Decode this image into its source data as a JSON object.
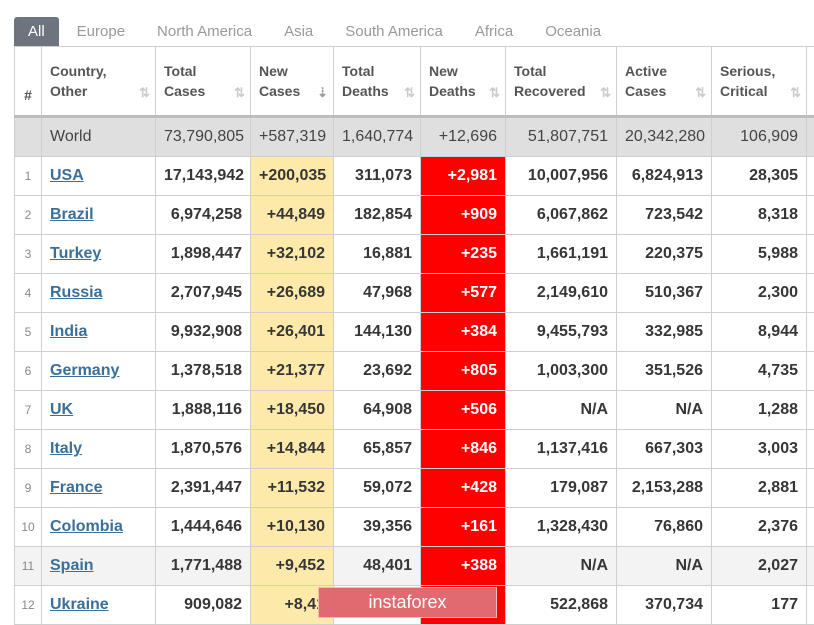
{
  "tabs": [
    {
      "label": "All",
      "active": true
    },
    {
      "label": "Europe",
      "active": false
    },
    {
      "label": "North America",
      "active": false
    },
    {
      "label": "Asia",
      "active": false
    },
    {
      "label": "South America",
      "active": false
    },
    {
      "label": "Africa",
      "active": false
    },
    {
      "label": "Oceania",
      "active": false
    }
  ],
  "table": {
    "headers": [
      {
        "line1": "#",
        "line2": ""
      },
      {
        "line1": "Country,",
        "line2": "Other"
      },
      {
        "line1": "Total",
        "line2": "Cases"
      },
      {
        "line1": "New",
        "line2": "Cases"
      },
      {
        "line1": "Total",
        "line2": "Deaths"
      },
      {
        "line1": "New",
        "line2": "Deaths"
      },
      {
        "line1": "Total",
        "line2": "Recovered"
      },
      {
        "line1": "Active",
        "line2": "Cases"
      },
      {
        "line1": "Serious,",
        "line2": "Critical"
      }
    ],
    "sort_icon": "⇅",
    "sort_active_icon": "⇣",
    "world": {
      "country": "World",
      "total_cases": "73,790,805",
      "new_cases": "+587,319",
      "total_deaths": "1,640,774",
      "new_deaths": "+12,696",
      "total_recovered": "51,807,751",
      "active_cases": "20,342,280",
      "serious_critical": "106,909"
    },
    "rows": [
      {
        "rank": "1",
        "country": "USA",
        "total_cases": "17,143,942",
        "new_cases": "+200,035",
        "total_deaths": "311,073",
        "new_deaths": "+2,981",
        "total_recovered": "10,007,956",
        "active_cases": "6,824,913",
        "serious_critical": "28,305"
      },
      {
        "rank": "2",
        "country": "Brazil",
        "total_cases": "6,974,258",
        "new_cases": "+44,849",
        "total_deaths": "182,854",
        "new_deaths": "+909",
        "total_recovered": "6,067,862",
        "active_cases": "723,542",
        "serious_critical": "8,318"
      },
      {
        "rank": "3",
        "country": "Turkey",
        "total_cases": "1,898,447",
        "new_cases": "+32,102",
        "total_deaths": "16,881",
        "new_deaths": "+235",
        "total_recovered": "1,661,191",
        "active_cases": "220,375",
        "serious_critical": "5,988"
      },
      {
        "rank": "4",
        "country": "Russia",
        "total_cases": "2,707,945",
        "new_cases": "+26,689",
        "total_deaths": "47,968",
        "new_deaths": "+577",
        "total_recovered": "2,149,610",
        "active_cases": "510,367",
        "serious_critical": "2,300"
      },
      {
        "rank": "5",
        "country": "India",
        "total_cases": "9,932,908",
        "new_cases": "+26,401",
        "total_deaths": "144,130",
        "new_deaths": "+384",
        "total_recovered": "9,455,793",
        "active_cases": "332,985",
        "serious_critical": "8,944"
      },
      {
        "rank": "6",
        "country": "Germany",
        "total_cases": "1,378,518",
        "new_cases": "+21,377",
        "total_deaths": "23,692",
        "new_deaths": "+805",
        "total_recovered": "1,003,300",
        "active_cases": "351,526",
        "serious_critical": "4,735"
      },
      {
        "rank": "7",
        "country": "UK",
        "total_cases": "1,888,116",
        "new_cases": "+18,450",
        "total_deaths": "64,908",
        "new_deaths": "+506",
        "total_recovered": "N/A",
        "active_cases": "N/A",
        "serious_critical": "1,288"
      },
      {
        "rank": "8",
        "country": "Italy",
        "total_cases": "1,870,576",
        "new_cases": "+14,844",
        "total_deaths": "65,857",
        "new_deaths": "+846",
        "total_recovered": "1,137,416",
        "active_cases": "667,303",
        "serious_critical": "3,003"
      },
      {
        "rank": "9",
        "country": "France",
        "total_cases": "2,391,447",
        "new_cases": "+11,532",
        "total_deaths": "59,072",
        "new_deaths": "+428",
        "total_recovered": "179,087",
        "active_cases": "2,153,288",
        "serious_critical": "2,881"
      },
      {
        "rank": "10",
        "country": "Colombia",
        "total_cases": "1,444,646",
        "new_cases": "+10,130",
        "total_deaths": "39,356",
        "new_deaths": "+161",
        "total_recovered": "1,328,430",
        "active_cases": "76,860",
        "serious_critical": "2,376"
      },
      {
        "rank": "11",
        "country": "Spain",
        "total_cases": "1,771,488",
        "new_cases": "+9,452",
        "total_deaths": "48,401",
        "new_deaths": "+388",
        "total_recovered": "N/A",
        "active_cases": "N/A",
        "serious_critical": "2,027",
        "highlight": true
      },
      {
        "rank": "12",
        "country": "Ukraine",
        "total_cases": "909,082",
        "new_cases": "+8,41",
        "total_deaths": "",
        "new_deaths": "",
        "total_recovered": "522,868",
        "active_cases": "370,734",
        "serious_critical": "177"
      }
    ]
  },
  "colors": {
    "tab_active_bg": "#6c757d",
    "new_cases_bg": "#fdeaab",
    "new_deaths_bg": "#ff0000",
    "world_row_bg": "#dfdfdf",
    "link_color": "#3a6f99"
  },
  "watermark": {
    "text": "instaforex"
  }
}
